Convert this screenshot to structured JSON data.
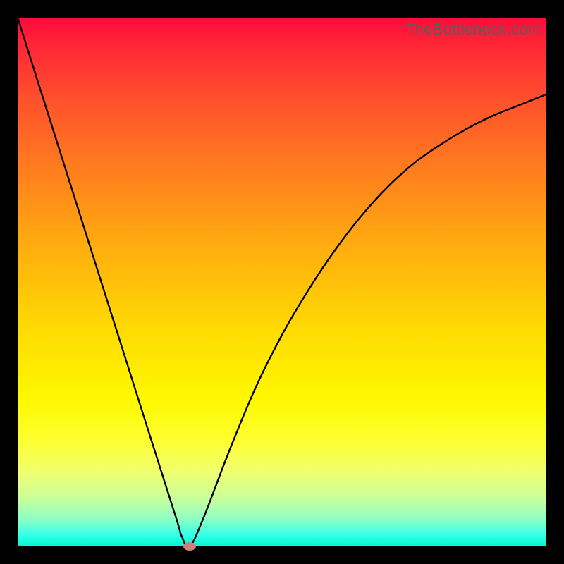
{
  "watermark": "TheBottleneck.com",
  "chart_data": {
    "type": "line",
    "title": "",
    "xlabel": "",
    "ylabel": "",
    "xlim": [
      0,
      100
    ],
    "ylim": [
      0,
      100
    ],
    "grid": false,
    "legend": false,
    "series": [
      {
        "name": "bottleneck-curve",
        "x": [
          0.0,
          5.0,
          10.0,
          15.0,
          20.0,
          25.0,
          30.0,
          31.0,
          32.5,
          35.0,
          40.0,
          45.0,
          50.0,
          55.0,
          60.0,
          65.0,
          70.0,
          75.0,
          80.0,
          85.0,
          90.0,
          95.0,
          100.0
        ],
        "y": [
          100.0,
          84.2,
          68.4,
          52.6,
          36.8,
          21.0,
          5.3,
          2.0,
          0.0,
          5.0,
          18.0,
          30.0,
          40.0,
          48.5,
          56.0,
          62.5,
          68.0,
          72.5,
          76.0,
          79.0,
          81.5,
          83.5,
          85.5
        ]
      }
    ],
    "marker": {
      "x": 32.5,
      "y": 0.0,
      "color": "#cc7f7a"
    },
    "gradient_stops": [
      {
        "pos": 0,
        "color": "#ff0a3a"
      },
      {
        "pos": 14,
        "color": "#ff4b2d"
      },
      {
        "pos": 28,
        "color": "#ff7b1f"
      },
      {
        "pos": 43,
        "color": "#ffac0f"
      },
      {
        "pos": 58,
        "color": "#ffd803"
      },
      {
        "pos": 72,
        "color": "#fff800"
      },
      {
        "pos": 86,
        "color": "#f0ff70"
      },
      {
        "pos": 95,
        "color": "#8affc6"
      },
      {
        "pos": 100,
        "color": "#00f7c9"
      }
    ]
  }
}
